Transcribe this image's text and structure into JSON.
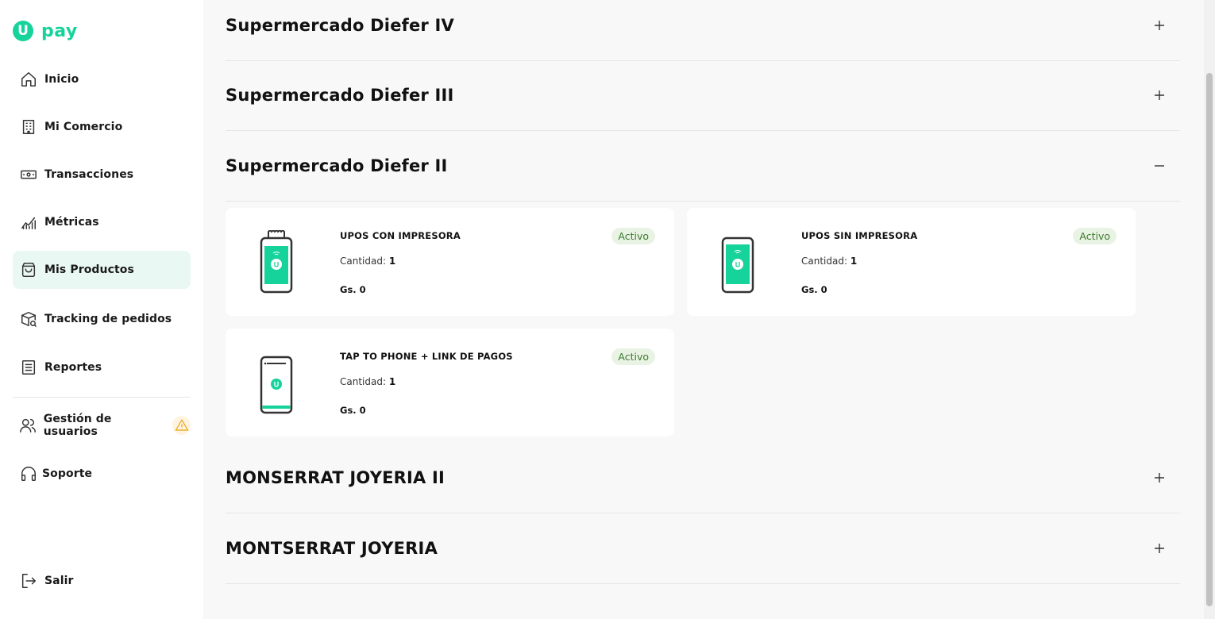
{
  "brand": {
    "mark": "U",
    "name": "pay",
    "color": "#16d39c"
  },
  "nav": {
    "items": [
      {
        "label": "Inicio",
        "icon": "home-icon"
      },
      {
        "label": "Mi Comercio",
        "icon": "building-icon"
      },
      {
        "label": "Transacciones",
        "icon": "money-icon"
      },
      {
        "label": "Métricas",
        "icon": "chart-icon"
      },
      {
        "label": "Mis Productos",
        "icon": "bag-icon",
        "active": true
      },
      {
        "label": "Tracking de pedidos",
        "icon": "package-icon"
      },
      {
        "label": "Reportes",
        "icon": "report-icon"
      },
      {
        "label": "Gestión de usuarios",
        "icon": "users-icon",
        "badge": "warning-icon"
      },
      {
        "label": "Soporte",
        "icon": "headset-icon"
      }
    ],
    "logout": {
      "label": "Salir",
      "icon": "logout-icon"
    }
  },
  "sections": [
    {
      "title": "Supermercado Diefer IV",
      "expanded": false
    },
    {
      "title": "Supermercado Diefer III",
      "expanded": false
    },
    {
      "title": "Supermercado Diefer II",
      "expanded": true
    },
    {
      "title": "MONSERRAT JOYERIA II",
      "expanded": false
    },
    {
      "title": "MONTSERRAT JOYERIA",
      "expanded": false
    }
  ],
  "products": [
    {
      "name": "UPOS CON IMPRESORA",
      "qty_label": "Cantidad:",
      "qty": "1",
      "price": "Gs. 0",
      "status": "Activo",
      "device": "pos-printer-icon"
    },
    {
      "name": "UPOS SIN IMPRESORA",
      "qty_label": "Cantidad:",
      "qty": "1",
      "price": "Gs. 0",
      "status": "Activo",
      "device": "pos-icon"
    },
    {
      "name": "TAP TO PHONE + LINK DE PAGOS",
      "qty_label": "Cantidad:",
      "qty": "1",
      "price": "Gs. 0",
      "status": "Activo",
      "device": "phone-icon"
    }
  ],
  "colors": {
    "accent": "#16d39c",
    "active_bg": "#e9f8f2",
    "badge_bg": "#e9f3e4",
    "badge_text": "#3d7a2e",
    "warning": "#e8a317"
  }
}
